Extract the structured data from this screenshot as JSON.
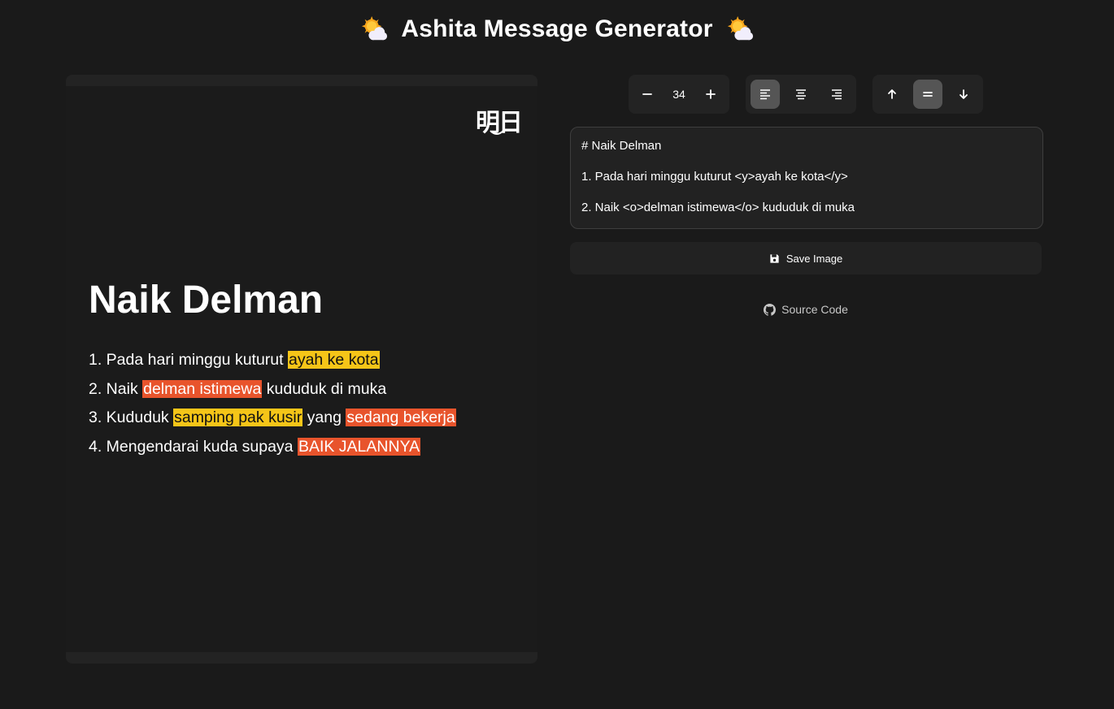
{
  "header": {
    "title": "Ashita Message Generator",
    "left_icon": "sun-behind-cloud-icon",
    "right_icon": "sun-behind-cloud-icon"
  },
  "preview": {
    "logo_text": "明日",
    "title": "Naik Delman",
    "items": [
      [
        {
          "t": "1. Pada hari minggu kuturut "
        },
        {
          "t": "ayah ke kota",
          "h": "y"
        }
      ],
      [
        {
          "t": "2. Naik "
        },
        {
          "t": "delman istimewa",
          "h": "o"
        },
        {
          "t": " kududuk di muka"
        }
      ],
      [
        {
          "t": "3. Kududuk "
        },
        {
          "t": "samping pak kusir",
          "h": "y"
        },
        {
          "t": " yang "
        },
        {
          "t": "sedang bekerja",
          "h": "o"
        }
      ],
      [
        {
          "t": "4. Mengendarai kuda supaya "
        },
        {
          "t": "BAIK JALANNYA",
          "h": "o"
        }
      ]
    ],
    "highlight_colors": {
      "y": "#f5c518",
      "o": "#e8542c"
    }
  },
  "toolbar": {
    "font_size": "34",
    "horizontal_align": "left",
    "vertical_align": "middle"
  },
  "editor": {
    "lines": [
      "# Naik Delman",
      "1. Pada hari minggu kuturut <y>ayah ke kota</y>",
      "2. Naik <o>delman istimewa</o> kududuk di muka"
    ]
  },
  "actions": {
    "save_label": "Save Image",
    "source_label": "Source Code"
  },
  "colors": {
    "background": "#1a1a1a",
    "panel": "#232323",
    "active_button": "#555555"
  }
}
